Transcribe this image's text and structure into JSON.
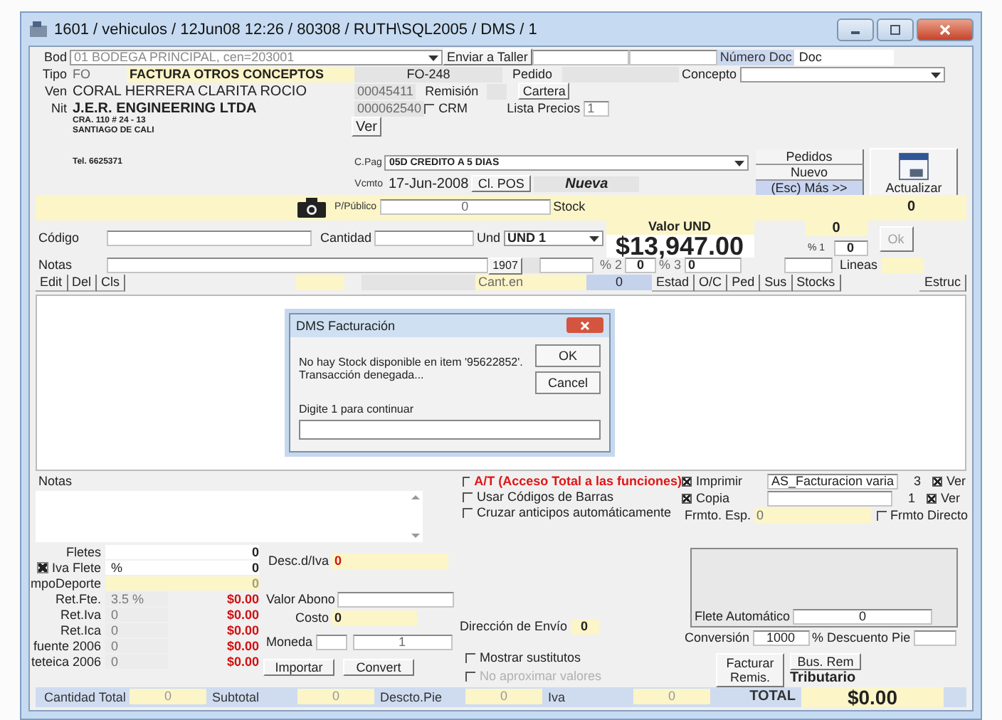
{
  "window": {
    "title": "1601 / vehiculos / 12Jun08 12:26 / 80308 / RUTH\\SQL2005 / DMS / 1"
  },
  "header": {
    "bod": {
      "label": "Bod",
      "value": "01  BODEGA PRINCIPAL, cen=203001",
      "disabled": true
    },
    "enviar_button": "Enviar a Taller",
    "numero_doc": {
      "label": "Número Doc",
      "value": "Doc"
    },
    "tipo": {
      "label": "Tipo",
      "code": "FO",
      "name": "FACTURA OTROS CONCEPTOS"
    },
    "doc_number": "FO-248",
    "pedido_label": "Pedido",
    "concepto_label": "Concepto",
    "ven": {
      "label": "Ven",
      "value": "CORAL HERRERA CLARITA ROCIO"
    },
    "nit": {
      "label": "Nit",
      "value": "J.E.R. ENGINEERING LTDA"
    },
    "codes": [
      "00045411",
      "000062540"
    ],
    "remision_label": "Remisión",
    "crm": {
      "label": "CRM",
      "checked": false
    },
    "cartera_button": "Cartera",
    "lista_precios": {
      "label": "Lista Precios",
      "value": "1"
    },
    "address": [
      "CRA. 110 # 24 - 13",
      "SANTIAGO DE CALI"
    ],
    "ver_button": "Ver",
    "tel": "Tel. 6625371",
    "cpag": {
      "label": "C.Pag",
      "value": "05D CREDITO A 5 DIAS"
    },
    "vcmto": {
      "label": "Vcmto",
      "value": "17-Jun-2008"
    },
    "pos_button": "Cl. POS",
    "status": "Nueva",
    "side_buttons": [
      {
        "label": "Pedidos",
        "kind": "plain"
      },
      {
        "label": "Nuevo",
        "kind": "plain"
      },
      {
        "label": "(Esc) Más >>",
        "kind": "accent"
      }
    ],
    "actualizar_button": "Actualizar",
    "publico": {
      "label": "P/Público",
      "value": "0"
    },
    "stock": {
      "label": "Stock",
      "value": "0"
    }
  },
  "item": {
    "codigo_label": "Código",
    "cantidad_label": "Cantidad",
    "und": {
      "label": "Und",
      "value": "UND 1"
    },
    "valor_label": "Valor UND",
    "valor": "$13,947.00",
    "qty": "0",
    "pct1": {
      "label": "% 1",
      "value": "0"
    },
    "ok_button": {
      "label": "Ok",
      "disabled": true
    },
    "notas_label": "Notas",
    "number": "1907",
    "pct2": {
      "label": "% 2",
      "value": "0"
    },
    "pct3": {
      "label": "% 3",
      "value": "0"
    },
    "lineas_label": "Lineas",
    "tools": [
      "Edit",
      "Del",
      "Cls"
    ],
    "cant_label": "Cant.en",
    "cant_value": "0",
    "tabs": [
      "Estad",
      "O/C",
      "Ped",
      "Sus",
      "Stocks"
    ],
    "estruc_button": "Estruc"
  },
  "dialog": {
    "title": "DMS Facturación",
    "message": [
      "No hay Stock disponible en item '95622852'.",
      "Transacción denegada..."
    ],
    "buttons": [
      "OK",
      "Cancel"
    ],
    "prompt": "Digite 1 para continuar"
  },
  "lower": {
    "notas_label": "Notas",
    "options": [
      {
        "label": "A/T (Acceso Total a las funciones)",
        "checked": false,
        "highlight": true
      },
      {
        "label": "Usar Códigos de Barras",
        "checked": false,
        "highlight": false
      },
      {
        "label": "Cruzar anticipos automáticamente",
        "checked": false,
        "highlight": false
      }
    ],
    "print": [
      {
        "label": "Imprimir",
        "checked": true,
        "format": "AS_Facturacion varia",
        "copies": "3",
        "ver": {
          "label": "Ver",
          "checked": true
        }
      },
      {
        "label": "Copia",
        "checked": true,
        "copies": "1",
        "ver": {
          "label": "Ver",
          "checked": true
        }
      }
    ],
    "frmto": {
      "label": "Frmto. Esp.",
      "value": "0",
      "directo": {
        "label": "Frmto Directo",
        "checked": false
      }
    },
    "charges": [
      {
        "label": "Fletes",
        "kind": "plain",
        "amount": "0"
      },
      {
        "label": "Iva Flete",
        "kind": "plain",
        "checked": true,
        "rate": "%",
        "amount": "0"
      },
      {
        "label": "mpoDeporte",
        "kind": "yellow",
        "amount": "0"
      },
      {
        "label": "Ret.Fte.",
        "kind": "money",
        "rate": "3.5 %",
        "amount": "$0.00"
      },
      {
        "label": "Ret.Iva",
        "kind": "money",
        "rate": "0",
        "amount": "$0.00"
      },
      {
        "label": "Ret.Ica",
        "kind": "money",
        "rate": "0",
        "amount": "$0.00"
      },
      {
        "label": "fuente 2006",
        "kind": "money",
        "rate": "0",
        "amount": "$0.00"
      },
      {
        "label": "teteica 2006",
        "kind": "money",
        "rate": "0",
        "amount": "$0.00"
      }
    ],
    "desc": {
      "label": "Desc.d/Iva",
      "value": "0"
    },
    "abono_label": "Valor Abono",
    "costo": {
      "label": "Costo",
      "value": "0"
    },
    "moneda": {
      "label": "Moneda",
      "value": "1"
    },
    "actions": [
      "Importar",
      "Convert"
    ],
    "direccion": {
      "label": "Dirección de Envío",
      "value": "0"
    },
    "flete": {
      "label": "Flete Automático",
      "value": "0"
    },
    "conversion": {
      "label": "Conversión",
      "value": "1000"
    },
    "descuento_label": "% Descuento Pie",
    "flags": [
      {
        "label": "Mostrar sustitutos",
        "checked": false,
        "disabled": false
      },
      {
        "label": "No aproximar valores",
        "checked": false,
        "disabled": true
      }
    ],
    "facturar_button": "Facturar Remis.",
    "busrem_button": "Bus. Rem",
    "tributario": "Tributario"
  },
  "totals": [
    {
      "label": "Cantidad Total",
      "value": "0",
      "kind": "plain"
    },
    {
      "label": "Subtotal",
      "value": "0",
      "kind": "plain"
    },
    {
      "label": "Descto.Pie",
      "value": "0",
      "kind": "plain"
    },
    {
      "label": "Iva",
      "value": "0",
      "kind": "plain"
    },
    {
      "label": "TOTAL",
      "value": "$0.00",
      "kind": "grand"
    }
  ]
}
